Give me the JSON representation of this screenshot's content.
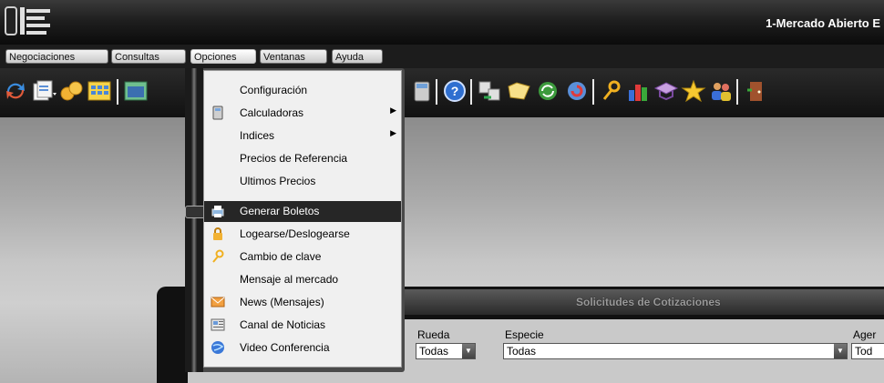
{
  "window": {
    "title": "1-Mercado Abierto E"
  },
  "menubar": {
    "items": [
      {
        "label": "Negociaciones"
      },
      {
        "label": "Consultas"
      },
      {
        "label": "Opciones"
      },
      {
        "label": "Ventanas"
      },
      {
        "label": "Ayuda"
      }
    ]
  },
  "toolbar": {
    "icons": [
      "refresh-icon",
      "documents-icon",
      "coins-icon",
      "calendar-grid-icon",
      "window-icon",
      "calculator-icon",
      "help-icon",
      "exchange-icon",
      "folder-icon",
      "sync-icon",
      "reload-icon",
      "key-icon",
      "bar-chart-icon",
      "graduation-cap-icon",
      "star-icon",
      "users-icon",
      "exit-door-icon"
    ]
  },
  "dropdown": {
    "items": [
      {
        "label": "Configuración",
        "icon": "",
        "submenu": false
      },
      {
        "label": "Calculadoras",
        "icon": "calculator-icon",
        "submenu": true
      },
      {
        "label": "Indices",
        "icon": "",
        "submenu": true
      },
      {
        "label": "Precios de Referencia",
        "icon": "",
        "submenu": false
      },
      {
        "label": "Ultimos Precios",
        "icon": "",
        "submenu": false
      },
      {
        "label": "Generar Boletos",
        "icon": "print-icon",
        "submenu": false,
        "highlighted": true
      },
      {
        "label": "Logearse/Deslogearse",
        "icon": "lock-icon",
        "submenu": false
      },
      {
        "label": "Cambio de clave",
        "icon": "key-icon",
        "submenu": false
      },
      {
        "label": "Mensaje al mercado",
        "icon": "",
        "submenu": false
      },
      {
        "label": "News (Mensajes)",
        "icon": "mail-icon",
        "submenu": false
      },
      {
        "label": "Canal de Noticias",
        "icon": "news-icon",
        "submenu": false
      },
      {
        "label": "Video Conferencia",
        "icon": "globe-icon",
        "submenu": false
      }
    ]
  },
  "subwindow": {
    "title": "Solicitudes de Cotizaciones",
    "fields": {
      "rueda": {
        "label": "Rueda",
        "value": "Todas"
      },
      "especie": {
        "label": "Especie",
        "value": "Todas"
      },
      "agente": {
        "label": "Ager",
        "value": "Tod"
      }
    }
  },
  "colors": {
    "highlight": "#262626",
    "menu_bg": "#f0f0f0",
    "workspace": "#c7c7c7"
  }
}
